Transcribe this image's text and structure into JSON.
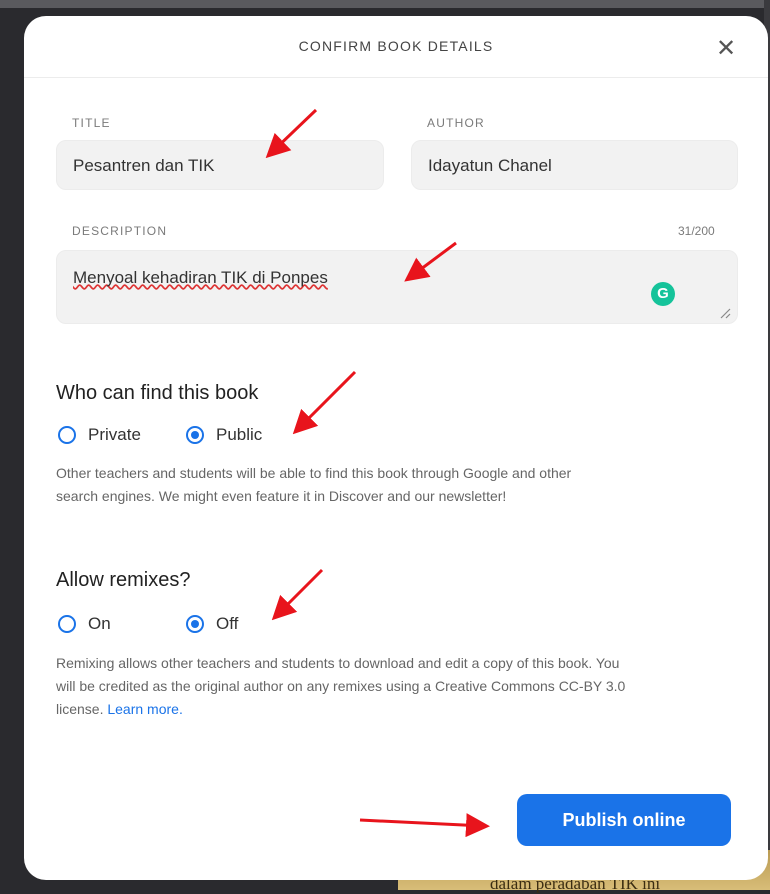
{
  "background": {
    "behind_text": "dalam peradaban TIK ini"
  },
  "dialog": {
    "title": "CONFIRM BOOK DETAILS",
    "close_icon": "close-icon"
  },
  "form": {
    "title": {
      "label": "TITLE",
      "value": "Pesantren dan TIK"
    },
    "author": {
      "label": "AUTHOR",
      "value": "Idayatun Chanel"
    },
    "description": {
      "label": "DESCRIPTION",
      "value": "Menyoal kehadiran TIK di Ponpes",
      "counter": "31/200"
    }
  },
  "visibility": {
    "heading": "Who can find this book",
    "options": [
      {
        "label": "Private",
        "checked": false
      },
      {
        "label": "Public",
        "checked": true
      }
    ],
    "help": "Other teachers and students will be able to find this book through Google and other search engines. We might even feature it in Discover and our newsletter!"
  },
  "remix": {
    "heading": "Allow remixes?",
    "options": [
      {
        "label": "On",
        "checked": false
      },
      {
        "label": "Off",
        "checked": true
      }
    ],
    "help": "Remixing allows other teachers and students to download and edit a copy of this book. You will be credited as the original author on any remixes using a Creative Commons CC-BY 3.0 license.",
    "link": "Learn more."
  },
  "actions": {
    "publish_label": "Publish online"
  },
  "colors": {
    "accent": "#1a73e8",
    "annotation_arrow": "#e8141c",
    "grammarly": "#15c39a"
  }
}
